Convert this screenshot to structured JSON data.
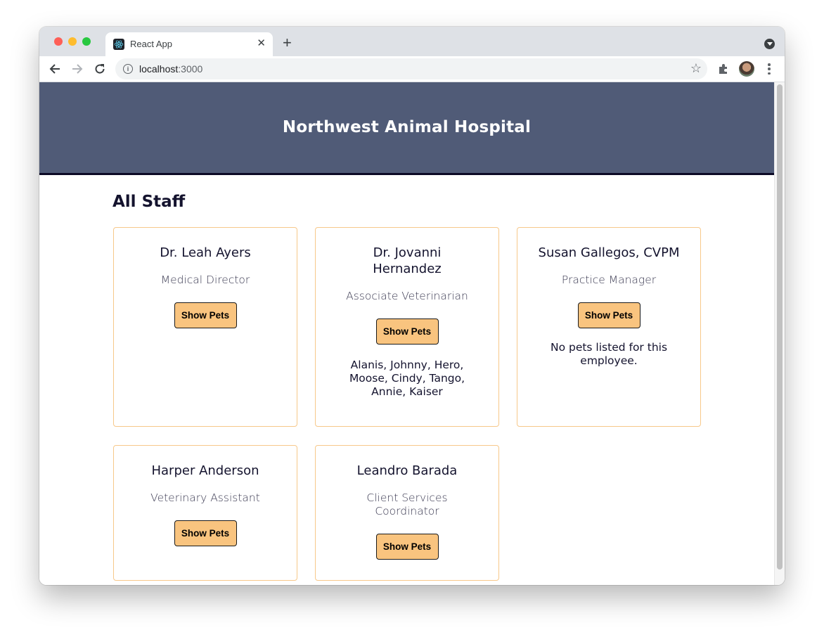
{
  "browser": {
    "tab_title": "React App",
    "tab_close": "✕",
    "new_tab": "+",
    "url_host": "localhost",
    "url_port": ":3000",
    "icons": {
      "favicon": "react-logo",
      "back": "arrow-left",
      "forward": "arrow-right",
      "reload": "reload",
      "info": "i",
      "bookmark": "☆",
      "extensions": "puzzle",
      "profile": "avatar",
      "menu": "kebab"
    }
  },
  "header": {
    "title": "Northwest Animal Hospital",
    "background": "#505b77"
  },
  "main": {
    "section_title": "All Staff",
    "button_color": "#f9c47f",
    "card_border": "#f7c88a",
    "staff": [
      {
        "name": "Dr. Leah Ayers",
        "role": "Medical Director",
        "button": "Show Pets",
        "pets": ""
      },
      {
        "name": "Dr. Jovanni Hernandez",
        "role": "Associate Veterinarian",
        "button": "Show Pets",
        "pets": "Alanis, Johnny, Hero, Moose, Cindy, Tango, Annie, Kaiser"
      },
      {
        "name": "Susan Gallegos, CVPM",
        "role": "Practice Manager",
        "button": "Show Pets",
        "pets": "No pets listed for this employee."
      },
      {
        "name": "Harper Anderson",
        "role": "Veterinary Assistant",
        "button": "Show Pets",
        "pets": ""
      },
      {
        "name": "Leandro Barada",
        "role": "Client Services Coordinator",
        "button": "Show Pets",
        "pets": ""
      }
    ]
  }
}
